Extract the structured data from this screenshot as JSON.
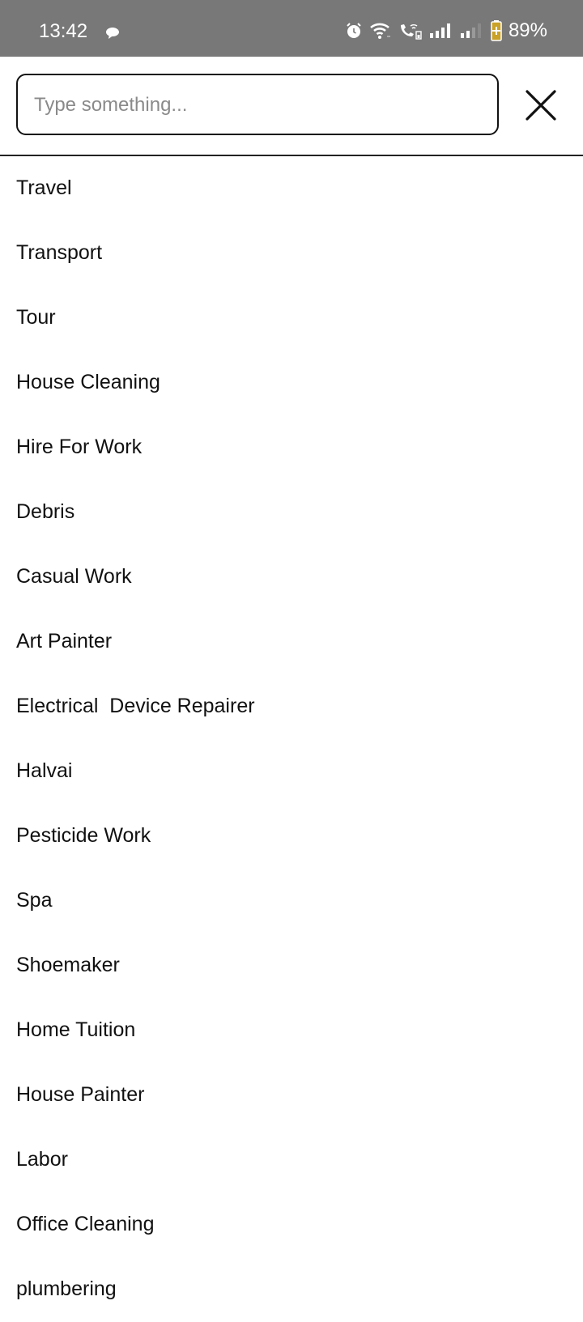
{
  "status_bar": {
    "time": "13:42",
    "battery": "89%",
    "icons": [
      "chat-bubble-icon",
      "alarm-icon",
      "wifi-icon",
      "wifi-call-icon",
      "signal-1-icon",
      "signal-2-icon",
      "battery-charging-icon"
    ],
    "battery_accent": "#c9a227"
  },
  "search": {
    "placeholder": "Type something...",
    "value": ""
  },
  "close_icon": "close-icon",
  "items": [
    "Travel",
    "Transport",
    "Tour",
    "House Cleaning",
    "Hire For Work",
    "Debris",
    "Casual Work",
    "Art Painter",
    "Electrical  Device Repairer",
    "Halvai",
    "Pesticide Work",
    "Spa",
    "Shoemaker",
    "Home Tuition",
    "House Painter",
    "Labor",
    "Office Cleaning",
    "plumbering"
  ]
}
